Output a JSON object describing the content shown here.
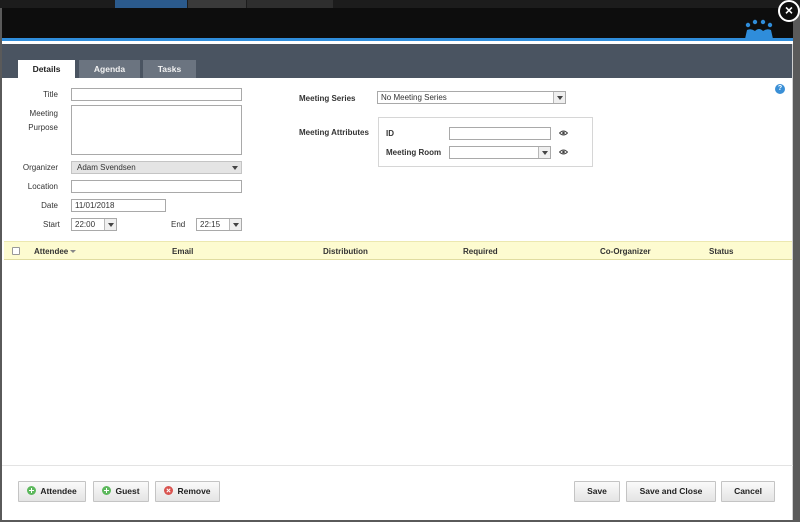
{
  "tabs": [
    {
      "label": "Details",
      "active": true
    },
    {
      "label": "Agenda",
      "active": false
    },
    {
      "label": "Tasks",
      "active": false
    }
  ],
  "form": {
    "title_label": "Title",
    "title_value": "",
    "purpose_label_line1": "Meeting",
    "purpose_label_line2": "Purpose",
    "purpose_value": "",
    "organizer_label": "Organizer",
    "organizer_value": "Adam Svendsen",
    "location_label": "Location",
    "location_value": "",
    "date_label": "Date",
    "date_value": "11/01/2018",
    "start_label": "Start",
    "start_value": "22:00",
    "end_label": "End",
    "end_value": "22:15"
  },
  "series": {
    "label": "Meeting Series",
    "value": "No Meeting Series"
  },
  "attributes": {
    "label": "Meeting Attributes",
    "id_label": "ID",
    "id_value": "",
    "room_label": "Meeting Room",
    "room_value": ""
  },
  "grid": {
    "columns": [
      "Attendee",
      "Email",
      "Distribution",
      "Required",
      "Co-Organizer",
      "Status"
    ]
  },
  "footer": {
    "attendee_button": "Attendee",
    "guest_button": "Guest",
    "remove_button": "Remove",
    "save_button": "Save",
    "save_close_button": "Save and Close",
    "cancel_button": "Cancel"
  },
  "icons": {
    "close": "close-icon",
    "help": "help-icon",
    "help_glyph": "?",
    "close_glyph": "×"
  },
  "colors": {
    "accent": "#2f8ddb",
    "header": "#0d0d0d",
    "tabstrip": "#4a5461",
    "grid_header": "#fdfbd0",
    "add_green": "#5cb85c",
    "remove_red": "#d9534f"
  }
}
